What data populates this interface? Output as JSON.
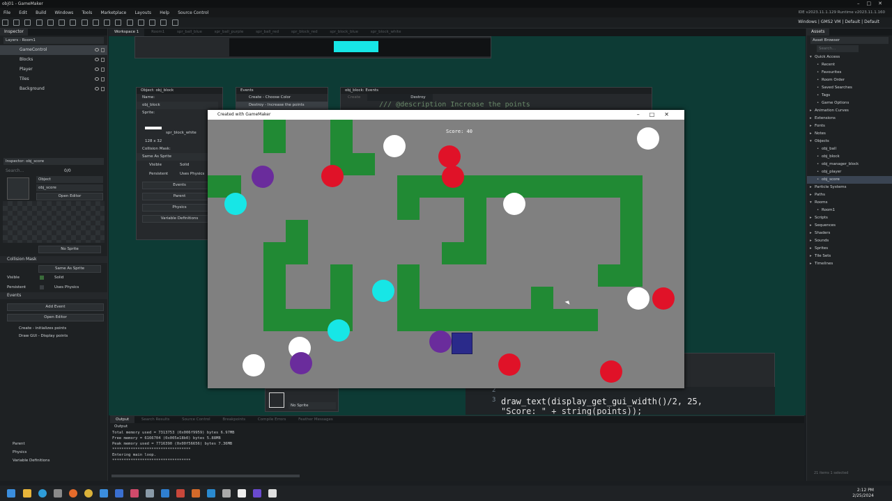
{
  "app": {
    "title": "obj01 - GameMaker",
    "version": "IDE v2023.11.1.129  Runtime v2023.11.1.160",
    "target": "Windows | GMS2 VM | Default | Default"
  },
  "menu": [
    "File",
    "Edit",
    "Build",
    "Windows",
    "Tools",
    "Marketplace",
    "Layouts",
    "Help",
    "Source Control"
  ],
  "left": {
    "tab": "Inspector",
    "layers_dropdown": "Layers - Room1",
    "layers": [
      "GameControl",
      "Blocks",
      "Player",
      "Tiles",
      "Background"
    ],
    "inspector_dropdown": "Inspector: obj_score",
    "search_placeholder": "Search...",
    "search_count": "0/0",
    "object_label": "Object",
    "object_name": "obj_score",
    "open_editor": "Open Editor",
    "no_sprite": "No Sprite",
    "collision_mask": "Collision Mask",
    "same_as_sprite": "Same As Sprite",
    "visible": "Visible",
    "solid": "Solid",
    "persistent": "Persistent",
    "uses_physics": "Uses Physics",
    "events_header": "Events",
    "add_event": "Add Event",
    "open_editor2": "Open Editor",
    "events": [
      "Create - initializes points",
      "Draw GUI - Display points"
    ],
    "bottom": [
      "Parent",
      "Physics",
      "Variable Definitions"
    ]
  },
  "workspace": {
    "tabs": [
      "Workspace 1",
      "Room1",
      "spr_ball_blue",
      "spr_ball_purple",
      "spr_ball_red",
      "spr_block_red",
      "spr_block_blue",
      "spr_block_white"
    ],
    "obj_window": {
      "title": "Object: obj_block",
      "name_label": "Name:",
      "name": "obj_block",
      "sprite_label": "Sprite:",
      "sprite": "spr_block_white",
      "size": "128 x 32",
      "collision": "Collision Mask:",
      "mask": "Same As Sprite",
      "visible": "Visible",
      "solid": "Solid",
      "persistent": "Persistent",
      "uses_physics": "Uses Physics",
      "buttons": [
        "Events",
        "Parent",
        "Physics",
        "Variable Definitions"
      ]
    },
    "events_window": {
      "title": "Events",
      "items": [
        "Create - Choose Color",
        "Destroy - Increase the points"
      ]
    },
    "code_window": {
      "title": "obj_block: Events",
      "tabs": [
        "Create",
        "Destroy"
      ],
      "comment": "/// @description Increase the points"
    },
    "code_lines": [
      {
        "num": "2",
        "text": ""
      },
      {
        "num": "3",
        "text": "draw_text(display_get_gui_width()/2, 25,"
      },
      {
        "num": "",
        "text": "    \"Score: \" + string(points));"
      }
    ],
    "small_panel_no_sprite": "No Sprite"
  },
  "game": {
    "title": "Created with GameMaker",
    "score": "Score: 40"
  },
  "right": {
    "tab": "Assets",
    "browser": "Asset Browser",
    "search_placeholder": "Search...",
    "tree": [
      {
        "label": "Quick Access",
        "level": 0,
        "open": true
      },
      {
        "label": "Recent",
        "level": 1
      },
      {
        "label": "Favourites",
        "level": 1
      },
      {
        "label": "Room Order",
        "level": 1
      },
      {
        "label": "Saved Searches",
        "level": 1
      },
      {
        "label": "Tags",
        "level": 1
      },
      {
        "label": "Game Options",
        "level": 1
      },
      {
        "label": "Animation Curves",
        "level": 0
      },
      {
        "label": "Extensions",
        "level": 0
      },
      {
        "label": "Fonts",
        "level": 0
      },
      {
        "label": "Notes",
        "level": 0
      },
      {
        "label": "Objects",
        "level": 0,
        "open": true
      },
      {
        "label": "obj_ball",
        "level": 1
      },
      {
        "label": "obj_block",
        "level": 1
      },
      {
        "label": "obj_manager_block",
        "level": 1
      },
      {
        "label": "obj_player",
        "level": 1
      },
      {
        "label": "obj_score",
        "level": 1,
        "sel": true
      },
      {
        "label": "Particle Systems",
        "level": 0
      },
      {
        "label": "Paths",
        "level": 0
      },
      {
        "label": "Rooms",
        "level": 0,
        "open": true
      },
      {
        "label": "Room1",
        "level": 1
      },
      {
        "label": "Scripts",
        "level": 0
      },
      {
        "label": "Sequences",
        "level": 0
      },
      {
        "label": "Shaders",
        "level": 0
      },
      {
        "label": "Sounds",
        "level": 0
      },
      {
        "label": "Sprites",
        "level": 0
      },
      {
        "label": "Tile Sets",
        "level": 0
      },
      {
        "label": "Timelines",
        "level": 0
      }
    ],
    "footer": "21 items  1 selected"
  },
  "output": {
    "tabs": [
      "Output",
      "Search Results",
      "Source Control",
      "Breakpoints",
      "Compile Errors",
      "Feather Messages"
    ],
    "label": "Output",
    "lines": [
      "Total memory used = 7313753 (0x006f9959) bytes 6.97MB",
      "Free memory = 6166704 (0x005e18b0) bytes 5.88MB",
      "Peak memory used = 7716390 (0x00f56656) bytes 7.36MB",
      "**********************************",
      "Entering main loop.",
      "**********************************"
    ]
  },
  "taskbar": {
    "time": "2:12 PM",
    "date": "2/25/2024"
  },
  "colors": {
    "wall": "#218a34",
    "floor": "#808080",
    "white": "#ffffff",
    "red": "#e01228",
    "cyan": "#17e6e6",
    "purple": "#6a2c9c",
    "player": "#2a2a8a"
  }
}
